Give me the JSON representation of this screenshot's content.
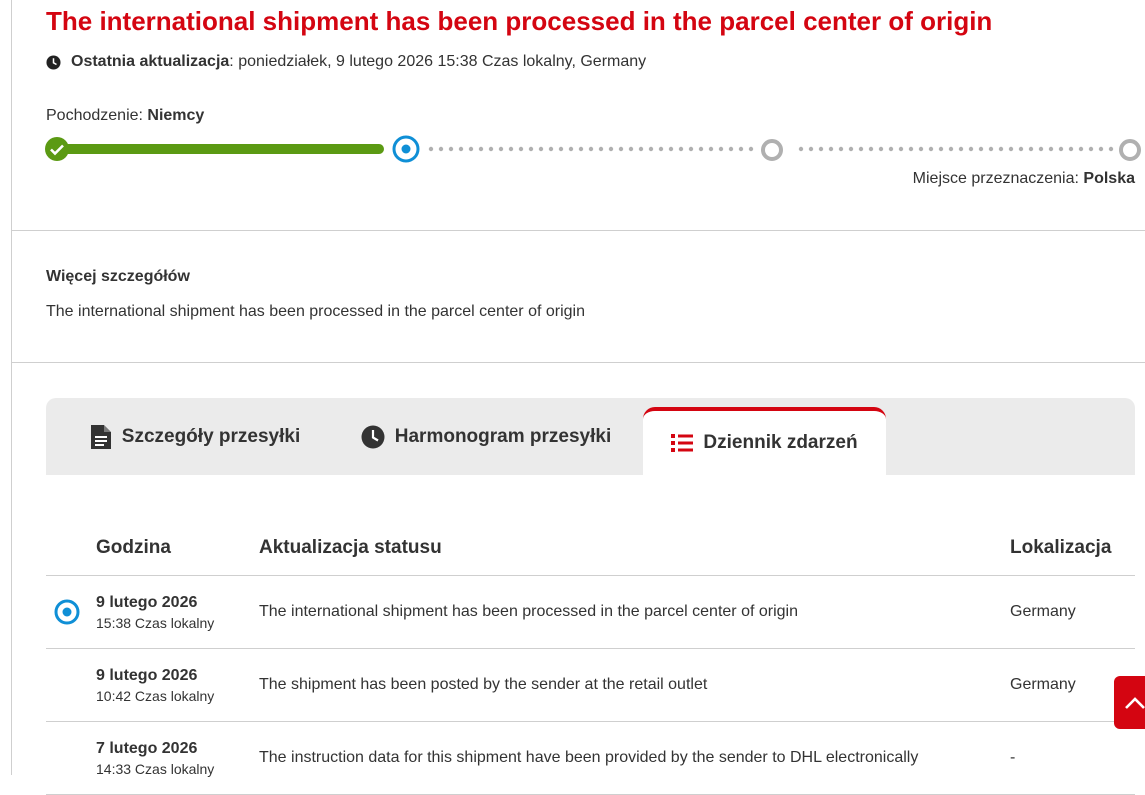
{
  "header": {
    "title": "The international shipment has been processed in the parcel center of origin",
    "last_update_label": "Ostatnia aktualizacja",
    "last_update_value": ": poniedziałek, 9 lutego 2026 15:38 Czas lokalny, Germany"
  },
  "route": {
    "origin_label": "Pochodzenie: ",
    "origin_value": "Niemcy",
    "destination_label": "Miejsce przeznaczenia: ",
    "destination_value": "Polska"
  },
  "details": {
    "heading": "Więcej szczegółów",
    "text": "The international shipment has been processed in the parcel center of origin"
  },
  "tabs": [
    {
      "label": "Szczegóły przesyłki",
      "icon": "document-icon",
      "active": false
    },
    {
      "label": "Harmonogram przesyłki",
      "icon": "clock-icon",
      "active": false
    },
    {
      "label": "Dziennik zdarzeń",
      "icon": "list-icon",
      "active": true
    }
  ],
  "events": {
    "columns": [
      "Godzina",
      "Aktualizacja statusu",
      "Lokalizacja"
    ],
    "rows": [
      {
        "date": "9 lutego 2026",
        "time": "15:38 Czas lokalny",
        "status": "The international shipment has been processed in the parcel center of origin",
        "location": "Germany"
      },
      {
        "date": "9 lutego 2026",
        "time": "10:42 Czas lokalny",
        "status": "The shipment has been posted by the sender at the retail outlet",
        "location": "Germany"
      },
      {
        "date": "7 lutego 2026",
        "time": "14:33 Czas lokalny",
        "status": "The instruction data for this shipment have been provided by the sender to DHL electronically",
        "location": "-"
      }
    ]
  },
  "colors": {
    "brand": "#d40511",
    "progress": "#5b9a13",
    "current": "#0f8fd6",
    "inactive": "#b0b0b0"
  }
}
